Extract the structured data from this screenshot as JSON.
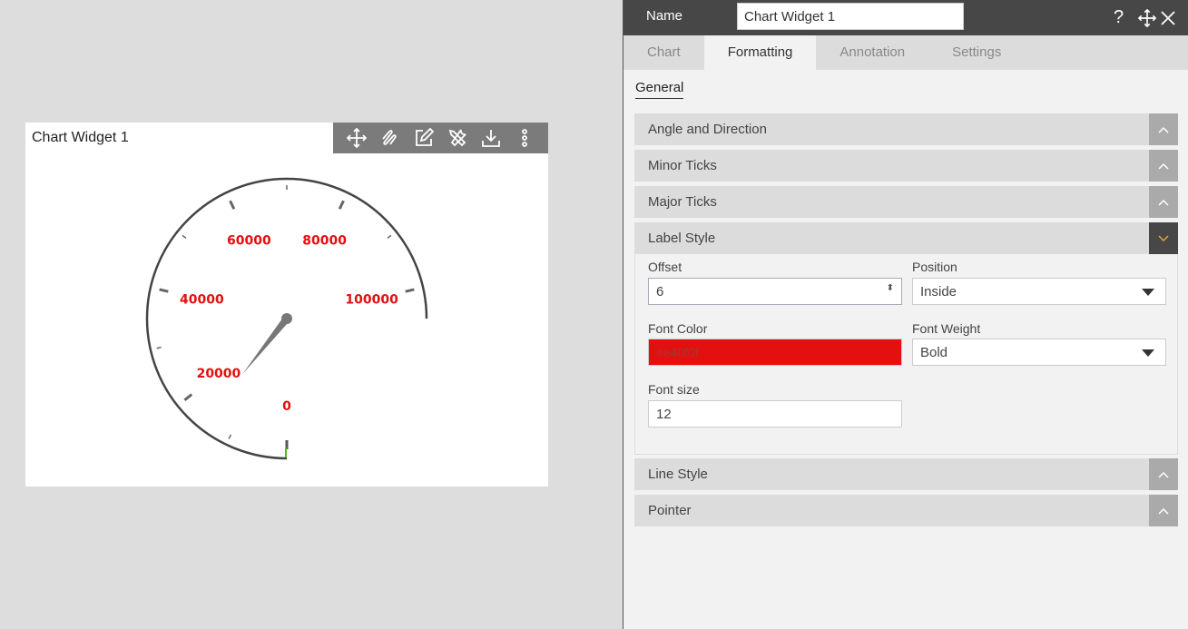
{
  "widget": {
    "title": "Chart Widget 1",
    "tools": [
      "move-icon",
      "link-icon",
      "edit-icon",
      "tools-icon",
      "download-icon",
      "more-icon"
    ]
  },
  "chart_data": {
    "type": "gauge",
    "min": 0,
    "max": 105000,
    "major_step": 20000,
    "minor_step": 10000,
    "tick_labels": [
      "0",
      "20000",
      "40000",
      "60000",
      "80000",
      "100000"
    ],
    "pointer_value": 15000,
    "label_color": "#e40f0f",
    "start_angle_deg": 0,
    "sweep_deg": 270
  },
  "panel": {
    "name_label": "Name",
    "name_value": "Chart Widget 1",
    "tabs": [
      {
        "label": "Chart"
      },
      {
        "label": "Formatting"
      },
      {
        "label": "Annotation"
      },
      {
        "label": "Settings"
      }
    ],
    "subtab": "General",
    "sections": [
      "Angle and Direction",
      "Minor Ticks",
      "Major Ticks",
      "Label Style",
      "Line Style",
      "Pointer"
    ],
    "label_style": {
      "offset_label": "Offset",
      "offset_value": "6",
      "position_label": "Position",
      "position_value": "Inside",
      "font_color_label": "Font Color",
      "font_color_value": "#e40f0f",
      "font_weight_label": "Font Weight",
      "font_weight_value": "Bold",
      "font_size_label": "Font size",
      "font_size_value": "12"
    }
  },
  "colors": {
    "accent": "#e6a23c",
    "header": "#474747"
  }
}
